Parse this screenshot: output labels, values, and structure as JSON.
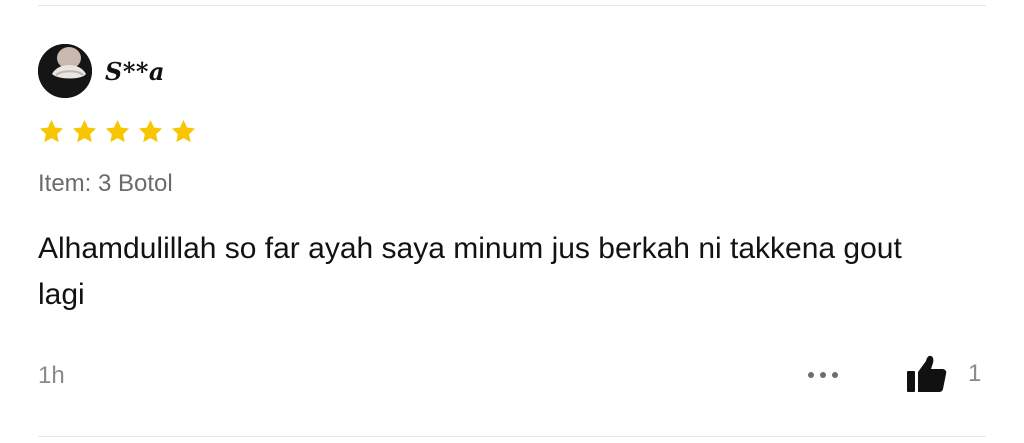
{
  "review": {
    "author": {
      "masked_name": "S**a",
      "avatar_icon": "user-avatar"
    },
    "rating": {
      "value": 5,
      "max": 5,
      "star_color": "#F7C600"
    },
    "variation": "Item: 3 Botol",
    "comment": "Alhamdulillah so far ayah saya minum jus berkah ni takkena gout lagi",
    "time_ago": "1h",
    "actions": {
      "more_icon": "more-horizontal-icon",
      "like_icon": "thumbs-up-icon",
      "like_count": "1"
    }
  }
}
